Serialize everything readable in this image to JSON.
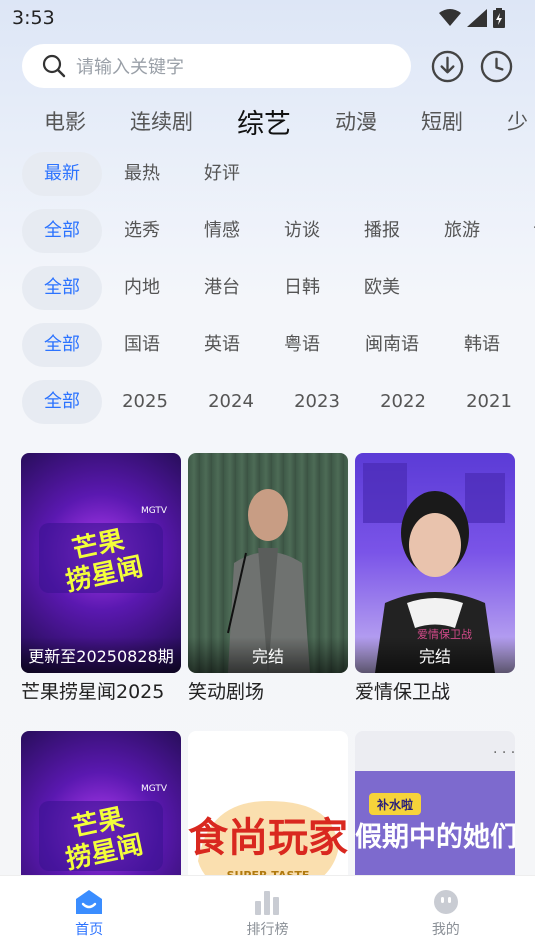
{
  "status_bar": {
    "time": "3:53"
  },
  "search": {
    "placeholder": "请输入关键字"
  },
  "categories": [
    "电影",
    "连续剧",
    "综艺",
    "动漫",
    "短剧",
    "少"
  ],
  "filters": {
    "sort": [
      "最新",
      "最热",
      "好评"
    ],
    "genre": [
      "全部",
      "选秀",
      "情感",
      "访谈",
      "播报",
      "旅游",
      "音"
    ],
    "region": [
      "全部",
      "内地",
      "港台",
      "日韩",
      "欧美"
    ],
    "language": [
      "全部",
      "国语",
      "英语",
      "粤语",
      "闽南语",
      "韩语"
    ],
    "year": [
      "全部",
      "2025",
      "2024",
      "2023",
      "2022",
      "2021"
    ]
  },
  "cards": [
    {
      "title": "芒果捞星闻2025",
      "badge": "更新至20250828期",
      "poster_text": "芒果捞星闻"
    },
    {
      "title": "笑动剧场",
      "badge": "完结"
    },
    {
      "title": "爱情保卫战",
      "badge": "完结",
      "poster_text": "爱情保卫战"
    },
    {
      "title": "",
      "badge": "",
      "poster_text": "芒果捞星闻"
    },
    {
      "title": "",
      "badge": "",
      "poster_text": "食尚玩家",
      "poster_subtext": "SUPER TASTE"
    },
    {
      "title": "",
      "badge": "",
      "poster_text": "假期中的她们",
      "poster_tag": "补水啦"
    }
  ],
  "bottom_nav": [
    {
      "label": "首页",
      "icon": "home-icon"
    },
    {
      "label": "排行榜",
      "icon": "bar-chart-icon"
    },
    {
      "label": "我的",
      "icon": "profile-icon"
    }
  ],
  "colors": {
    "accent": "#2c73ff",
    "chip_bg": "#e7ebf2"
  }
}
